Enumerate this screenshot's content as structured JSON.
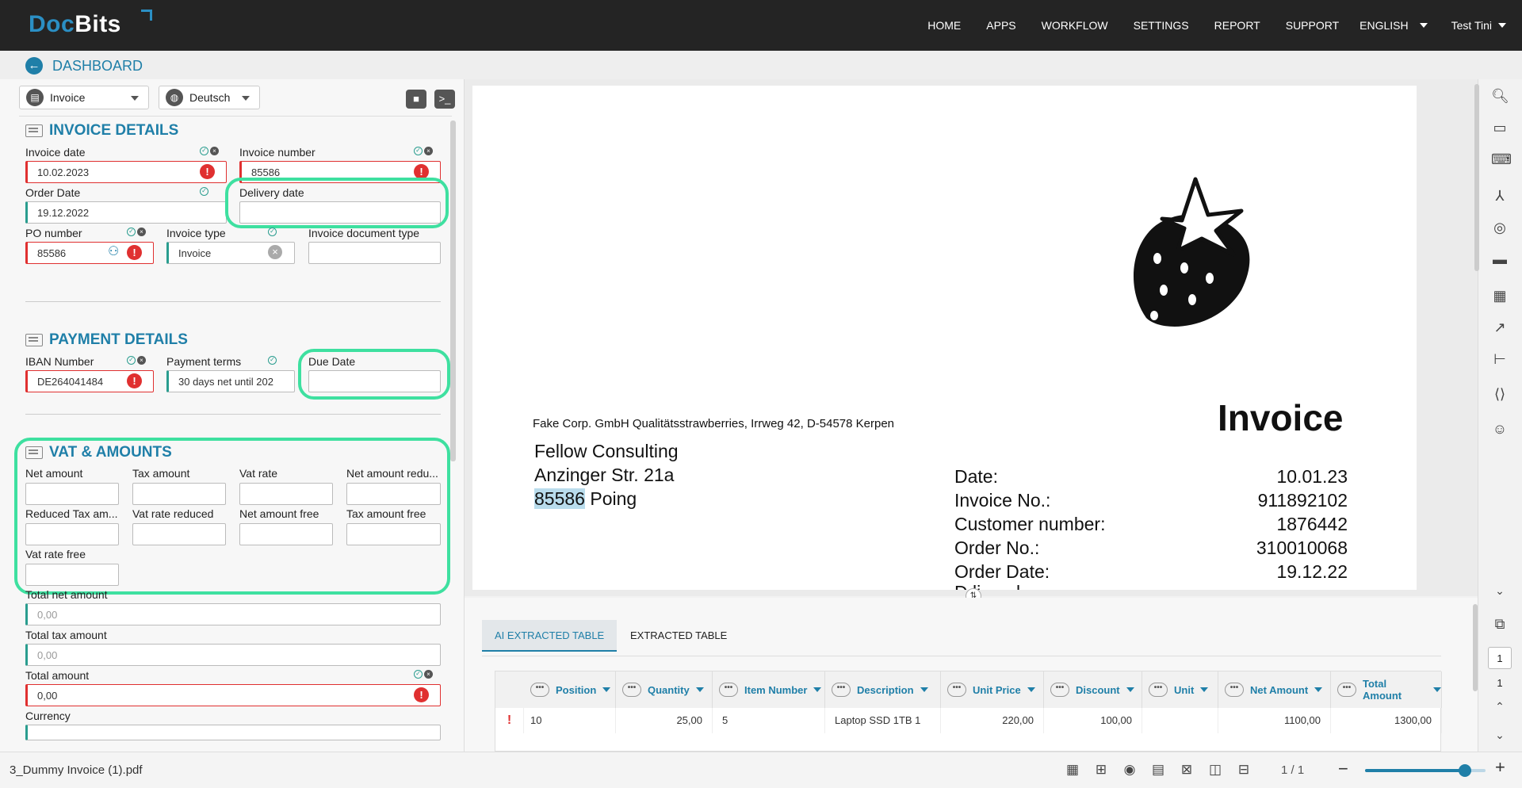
{
  "brand": {
    "logo_doc": "Doc",
    "logo_bits": "Bits"
  },
  "nav": {
    "home": "HOME",
    "apps": "APPS",
    "workflow": "WORKFLOW",
    "settings": "SETTINGS",
    "report": "REPORT",
    "support": "SUPPORT",
    "language": "ENGLISH",
    "user": "Test Tini"
  },
  "dashboard": {
    "title": "DASHBOARD"
  },
  "toolbar": {
    "doctype": "Invoice",
    "language": "Deutsch"
  },
  "invoice_details": {
    "title": "INVOICE DETAILS",
    "invoice_date_label": "Invoice date",
    "invoice_date": "10.02.2023",
    "invoice_number_label": "Invoice number",
    "invoice_number": "85586",
    "order_date_label": "Order Date",
    "order_date": "19.12.2022",
    "delivery_date_label": "Delivery date",
    "delivery_date": "",
    "po_number_label": "PO number",
    "po_number": "85586",
    "invoice_type_label": "Invoice type",
    "invoice_type": "Invoice",
    "invoice_doc_type_label": "Invoice document type",
    "invoice_doc_type": ""
  },
  "payment_details": {
    "title": "PAYMENT DETAILS",
    "iban_label": "IBAN Number",
    "iban": "DE264041484",
    "payment_terms_label": "Payment terms",
    "payment_terms": "30 days net until 202",
    "due_date_label": "Due Date",
    "due_date": ""
  },
  "vat": {
    "title": "VAT & AMOUNTS",
    "net_amount": "Net amount",
    "tax_amount": "Tax amount",
    "vat_rate": "Vat rate",
    "net_amount_reduced": "Net amount redu...",
    "reduced_tax_amount": "Reduced Tax am...",
    "vat_rate_reduced": "Vat rate reduced",
    "net_amount_free": "Net amount free",
    "tax_amount_free": "Tax amount free",
    "vat_rate_free": "Vat rate free",
    "total_net_label": "Total net amount",
    "total_net": "0,00",
    "total_tax_label": "Total tax amount",
    "total_tax": "0,00",
    "total_amount_label": "Total amount",
    "total_amount": "0,00",
    "currency_label": "Currency"
  },
  "document": {
    "sender": "Fake Corp. GmbH Qualitätsstrawberries, Irrweg 42, D-54578 Kerpen",
    "recipient_name": "Fellow Consulting",
    "recipient_street": "Anzinger Str. 21a",
    "recipient_zip": "85586",
    "recipient_city": " Poing",
    "heading": "Invoice",
    "meta": [
      {
        "label": "Date:",
        "value": "10.01.23"
      },
      {
        "label": "Invoice No.:",
        "value": "911892102"
      },
      {
        "label": "Customer number:",
        "value": "1876442"
      },
      {
        "label": "Order No.:",
        "value": "310010068"
      },
      {
        "label": "Order Date:",
        "value": "19.12.22"
      }
    ]
  },
  "tables": {
    "tab_ai": "AI EXTRACTED TABLE",
    "tab_extracted": "EXTRACTED TABLE"
  },
  "grid": {
    "columns": [
      "Position",
      "Quantity",
      "Item Number",
      "Description",
      "Unit Price",
      "Discount",
      "Unit",
      "Net Amount",
      "Total Amount"
    ],
    "row": {
      "flag": "!",
      "position": "10",
      "quantity": "25,00",
      "item_number": "5",
      "description": "Laptop SSD 1TB 1",
      "unit_price": "220,00",
      "discount": "100,00",
      "unit": "",
      "net_amount": "1100,00",
      "total_amount": "1300,00"
    }
  },
  "pager": {
    "page_input": "1",
    "page_total": "1"
  },
  "footer": {
    "filename": "3_Dummy Invoice (1).pdf",
    "pages": "1 / 1",
    "zoom_percent": 83
  },
  "colors": {
    "accent": "#1f7fa8",
    "highlight": "#3ee0a0",
    "error": "#e03030",
    "valid": "#2a9d8f"
  }
}
